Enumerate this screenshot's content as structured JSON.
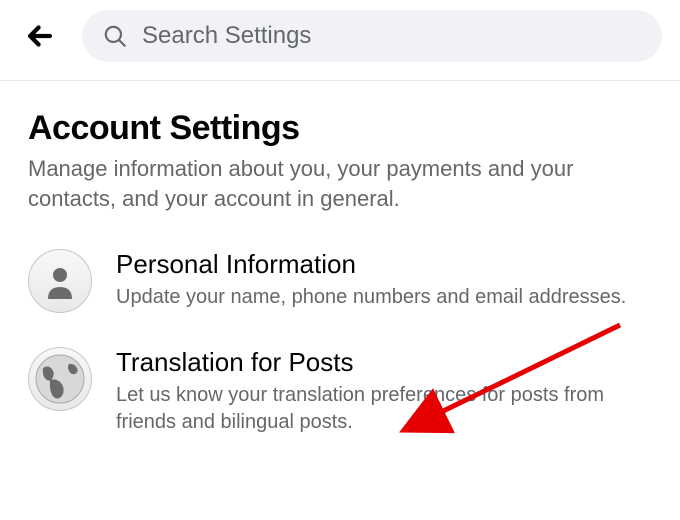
{
  "header": {
    "search_placeholder": "Search Settings"
  },
  "page": {
    "title": "Account Settings",
    "subtitle": "Manage information about you, your payments and your contacts, and your account in general."
  },
  "settings": {
    "personal_info": {
      "title": "Personal Information",
      "desc": "Update your name, phone numbers and email addresses."
    },
    "translation": {
      "title": "Translation for Posts",
      "desc": "Let us know your translation preferences for posts from friends and bilingual posts."
    }
  },
  "colors": {
    "text_primary": "#050505",
    "text_secondary": "#65676b",
    "search_bg": "#f0f2f5",
    "annotation_red": "#e60000"
  }
}
